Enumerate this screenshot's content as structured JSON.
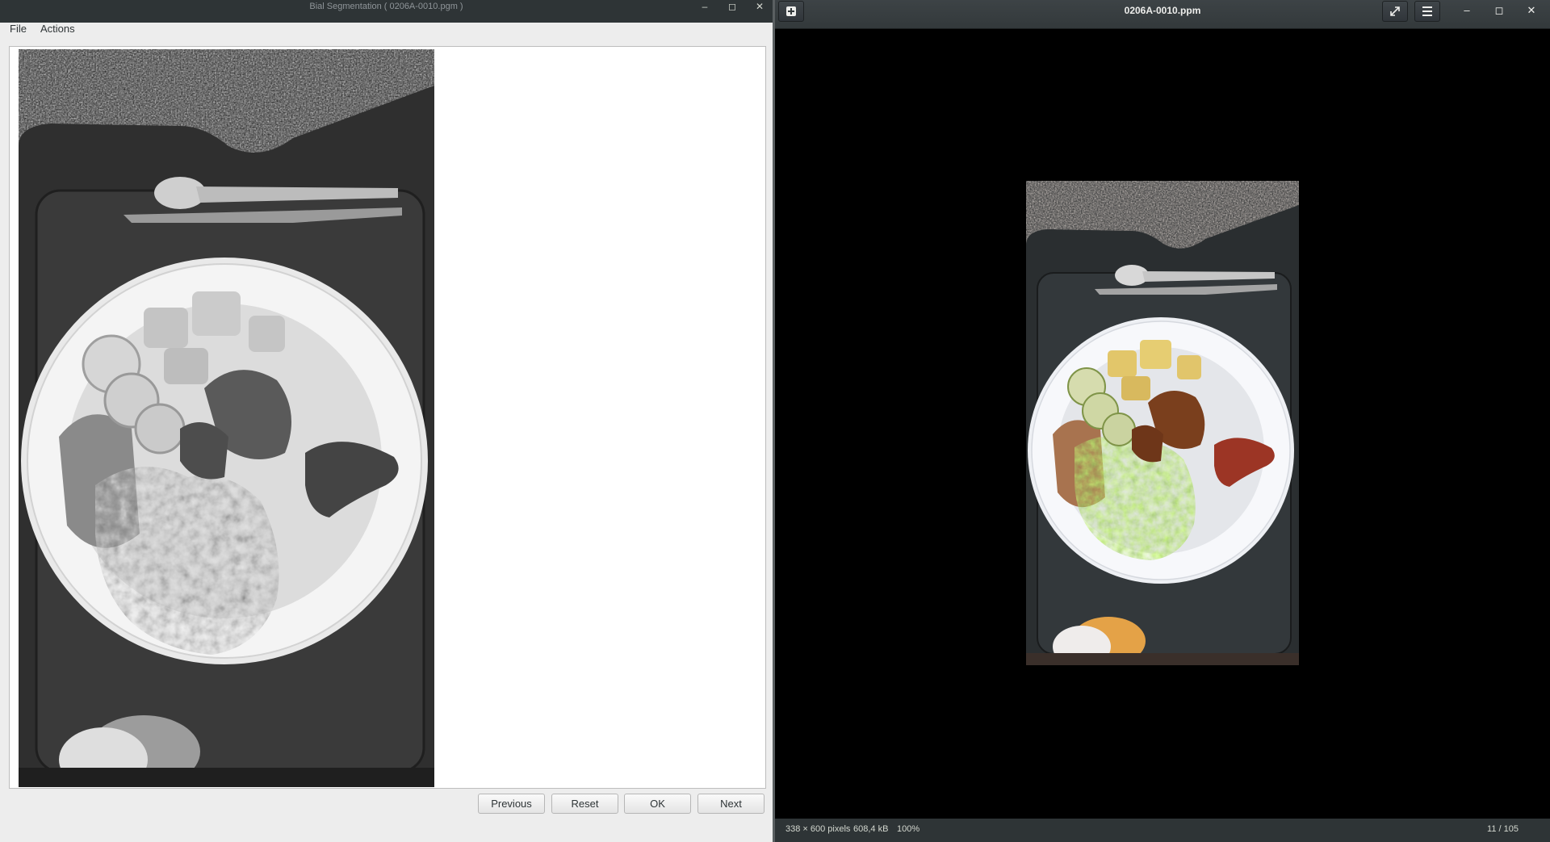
{
  "left_window": {
    "title": "Bial Segmentation ( 0206A-0010.pgm )",
    "menu": [
      "File",
      "Actions"
    ],
    "buttons": {
      "previous": "Previous",
      "reset": "Reset",
      "ok": "OK",
      "next": "Next"
    },
    "window_controls": {
      "minimize": "–",
      "maximize": "◻",
      "close": "✕"
    }
  },
  "right_window": {
    "title": "0206A-0010.ppm",
    "header_icons": [
      "add-icon",
      "fullscreen-icon",
      "hamburger-menu-icon"
    ],
    "window_controls": {
      "minimize": "–",
      "maximize": "◻",
      "close": "✕"
    },
    "status": {
      "dimensions": "338 × 600 pixels",
      "file_size": "608,4 kB",
      "zoom": "100%",
      "index": "11 / 105"
    }
  }
}
